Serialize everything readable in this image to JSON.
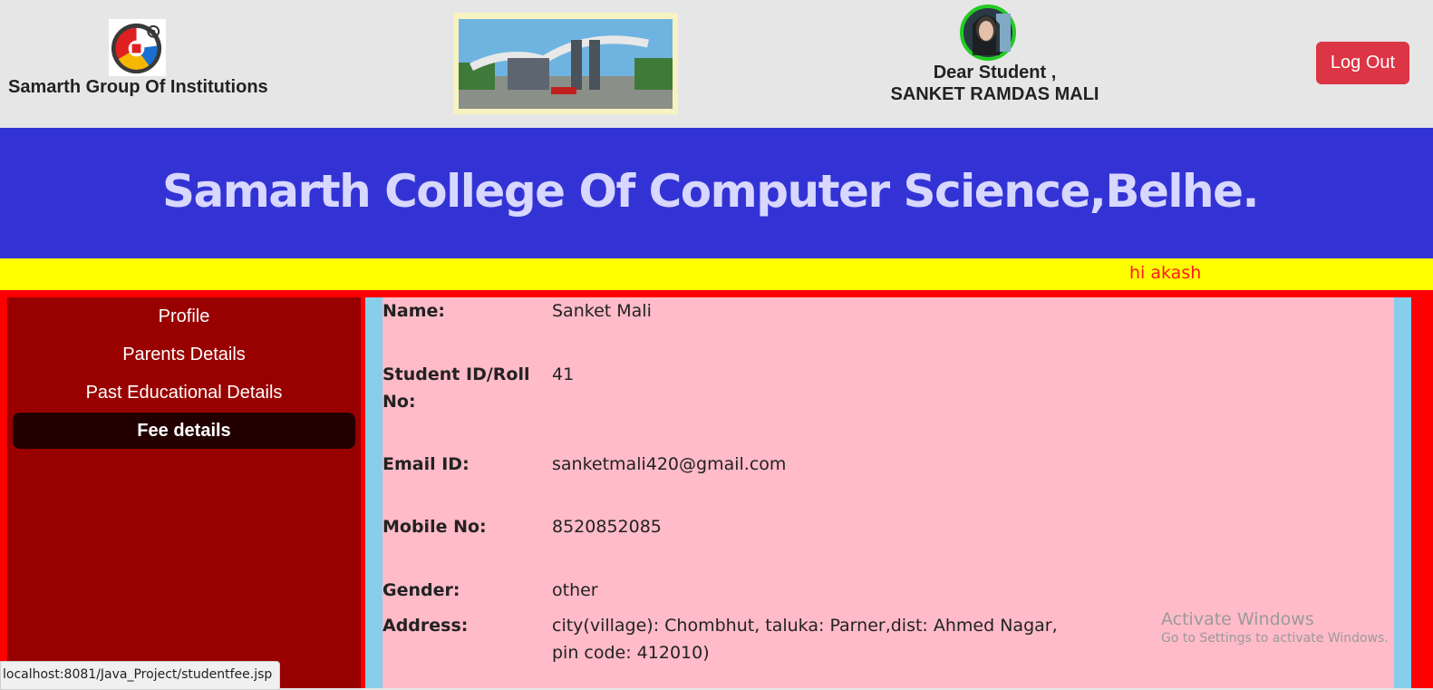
{
  "header": {
    "institution_name": "Samarth Group Of Institutions",
    "greeting_line1": "Dear Student ,",
    "greeting_line2": "SANKET RAMDAS MALI",
    "logout_label": "Log Out"
  },
  "banner": {
    "title": "Samarth College Of Computer Science,Belhe."
  },
  "ticker": {
    "text": "hi akash"
  },
  "sidebar": {
    "items": [
      {
        "label": "Profile",
        "active": false
      },
      {
        "label": "Parents Details",
        "active": false
      },
      {
        "label": "Past Educational Details",
        "active": false
      },
      {
        "label": "Fee details",
        "active": true
      }
    ]
  },
  "student": {
    "name_label": "Name:",
    "name": "Sanket Mali",
    "id_label": "Student ID/Roll No:",
    "id": "41",
    "email_label": "Email ID:",
    "email": "sanketmali420@gmail.com",
    "mobile_label": "Mobile No:",
    "mobile": "8520852085",
    "gender_label": "Gender:",
    "gender": "other",
    "address_label": "Address:",
    "address": "city(village): Chombhut, taluka: Parner,dist: Ahmed Nagar, pin code: 412010)"
  },
  "watermark": {
    "line1": "Activate Windows",
    "line2": "Go to Settings to activate Windows."
  },
  "statusbar": {
    "url": "localhost:8081/Java_Project/studentfee.jsp"
  },
  "colors": {
    "banner": "#3333d5",
    "ticker": "#ffff00",
    "sidebar": "#990000",
    "content": "#ffbbc8",
    "logout": "#dc3545"
  }
}
